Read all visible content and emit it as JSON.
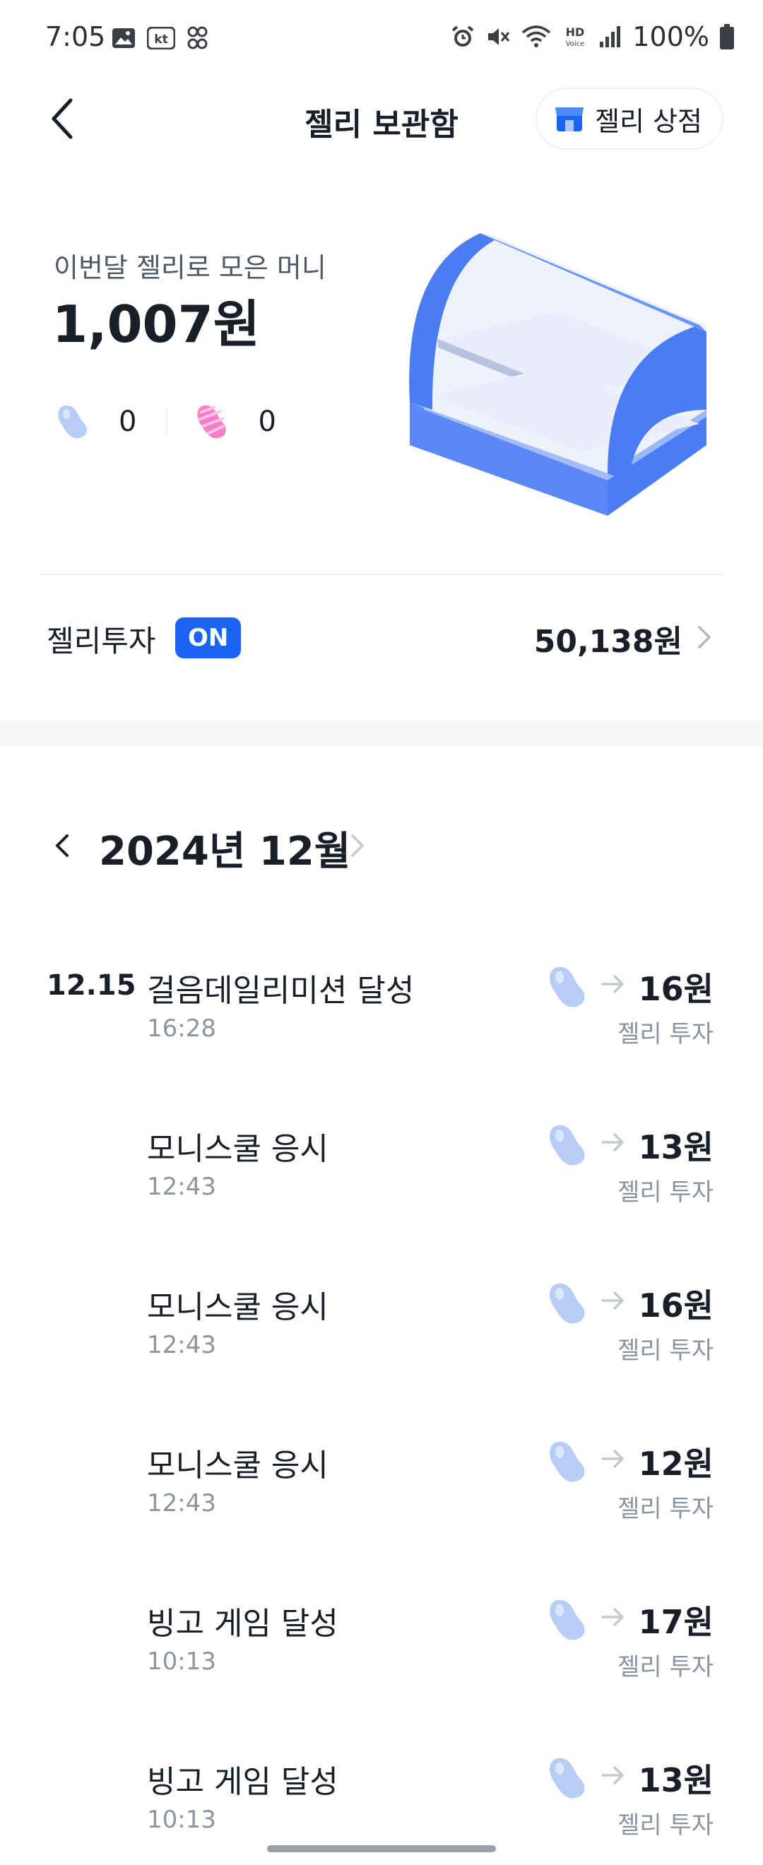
{
  "status_bar": {
    "time": "7:05",
    "left_icons": [
      "gallery-icon",
      "kt-icon",
      "app-icon"
    ],
    "right_icons": [
      "alarm-icon",
      "mute-icon",
      "wifi-icon",
      "hd-voice-icon",
      "signal-icon",
      "battery-icon"
    ],
    "battery": "100%",
    "kt_label": "kt",
    "hd_label": "HD",
    "voice_label": "Voice"
  },
  "header": {
    "title": "젤리 보관함",
    "store_button": "젤리 상점"
  },
  "summary": {
    "label": "이번달 젤리로 모은 머니",
    "amount": "1,007원",
    "blue_jelly_count": "0",
    "pink_jelly_count": "0"
  },
  "invest": {
    "label": "젤리투자",
    "badge": "ON",
    "amount": "50,138원"
  },
  "month": {
    "title": "2024년 12월"
  },
  "entries": [
    {
      "date": "12.15",
      "title": "걸음데일리미션 달성",
      "time": "16:28",
      "amount": "16원",
      "type": "젤리 투자"
    },
    {
      "date": "",
      "title": "모니스쿨 응시",
      "time": "12:43",
      "amount": "13원",
      "type": "젤리 투자"
    },
    {
      "date": "",
      "title": "모니스쿨 응시",
      "time": "12:43",
      "amount": "16원",
      "type": "젤리 투자"
    },
    {
      "date": "",
      "title": "모니스쿨 응시",
      "time": "12:43",
      "amount": "12원",
      "type": "젤리 투자"
    },
    {
      "date": "",
      "title": "빙고 게임 달성",
      "time": "10:13",
      "amount": "17원",
      "type": "젤리 투자"
    },
    {
      "date": "",
      "title": "빙고 게임 달성",
      "time": "10:13",
      "amount": "13원",
      "type": "젤리 투자"
    }
  ],
  "colors": {
    "accent": "#1b64f2",
    "jelly_blue": "#a9c6f7",
    "jelly_pink": "#f47fc6",
    "showcase_blue": "#4c7cf3"
  }
}
